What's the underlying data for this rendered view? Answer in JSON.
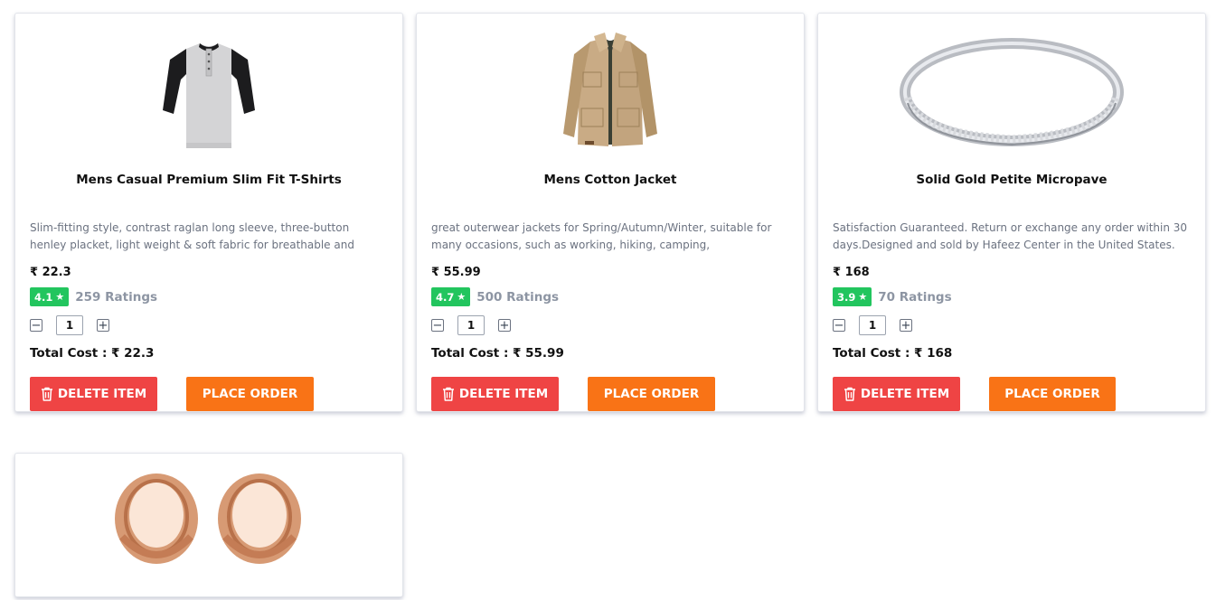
{
  "products": [
    {
      "title": "Mens Casual Premium Slim Fit T-Shirts",
      "description": "Slim-fitting style, contrast raglan long sleeve, three-button henley placket, light weight & soft fabric for breathable and comfortable",
      "price": "₹ 22.3",
      "rating": "4.1",
      "ratings_count": "259 Ratings",
      "quantity": "1",
      "total_cost": "Total Cost : ₹ 22.3",
      "image_icon": "tshirt-image"
    },
    {
      "title": "Mens Cotton Jacket",
      "description": "great outerwear jackets for Spring/Autumn/Winter, suitable for many occasions, such as working, hiking, camping, mountain/rock climbing,",
      "price": "₹ 55.99",
      "rating": "4.7",
      "ratings_count": "500 Ratings",
      "quantity": "1",
      "total_cost": "Total Cost : ₹ 55.99",
      "image_icon": "jacket-image"
    },
    {
      "title": "Solid Gold Petite Micropave",
      "description": "Satisfaction Guaranteed. Return or exchange any order within 30 days.Designed and sold by Hafeez Center in the United States.",
      "price": "₹ 168",
      "rating": "3.9",
      "ratings_count": "70 Ratings",
      "quantity": "1",
      "total_cost": "Total Cost : ₹ 168",
      "image_icon": "ring-image"
    },
    {
      "image_icon": "rose-gold-tunnel-plugs-image"
    }
  ],
  "buttons": {
    "delete_label": "DELETE ITEM",
    "order_label": "PLACE ORDER",
    "minus": "−",
    "plus": "+"
  },
  "colors": {
    "delete": "#ef4444",
    "order": "#f97316",
    "rating_badge": "#22c55e"
  }
}
